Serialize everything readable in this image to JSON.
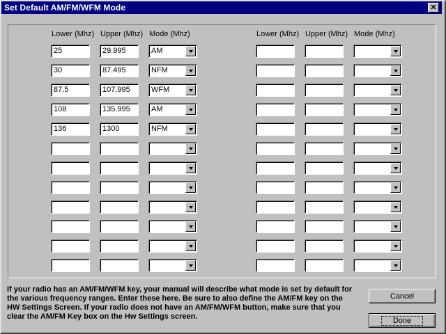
{
  "window": {
    "title": "Set Default AM/FM/WFM Mode"
  },
  "headers": {
    "lower": "Lower (Mhz)",
    "upper": "Upper (Mhz)",
    "mode": "Mode (Mhz)"
  },
  "left_rows": [
    {
      "lower": "25",
      "upper": "29.995",
      "mode": "AM"
    },
    {
      "lower": "30",
      "upper": "87.495",
      "mode": "NFM"
    },
    {
      "lower": "87.5",
      "upper": "107.995",
      "mode": "WFM"
    },
    {
      "lower": "108",
      "upper": "135.995",
      "mode": "AM"
    },
    {
      "lower": "136",
      "upper": "1300",
      "mode": "NFM"
    },
    {
      "lower": "",
      "upper": "",
      "mode": ""
    },
    {
      "lower": "",
      "upper": "",
      "mode": ""
    },
    {
      "lower": "",
      "upper": "",
      "mode": ""
    },
    {
      "lower": "",
      "upper": "",
      "mode": ""
    },
    {
      "lower": "",
      "upper": "",
      "mode": ""
    },
    {
      "lower": "",
      "upper": "",
      "mode": ""
    },
    {
      "lower": "",
      "upper": "",
      "mode": ""
    }
  ],
  "right_rows": [
    {
      "lower": "",
      "upper": "",
      "mode": ""
    },
    {
      "lower": "",
      "upper": "",
      "mode": ""
    },
    {
      "lower": "",
      "upper": "",
      "mode": ""
    },
    {
      "lower": "",
      "upper": "",
      "mode": ""
    },
    {
      "lower": "",
      "upper": "",
      "mode": ""
    },
    {
      "lower": "",
      "upper": "",
      "mode": ""
    },
    {
      "lower": "",
      "upper": "",
      "mode": ""
    },
    {
      "lower": "",
      "upper": "",
      "mode": ""
    },
    {
      "lower": "",
      "upper": "",
      "mode": ""
    },
    {
      "lower": "",
      "upper": "",
      "mode": ""
    },
    {
      "lower": "",
      "upper": "",
      "mode": ""
    },
    {
      "lower": "",
      "upper": "",
      "mode": ""
    }
  ],
  "help_text": "If your radio has an AM/FM/WFM key, your manual will describe what mode is set by default for the various frequency ranges. Enter these here. Be sure to also define the AM/FM key on the HW Settings Screen. If your radio does not have an AM/FM/WFM button, make sure that you clear the AM/FM Key box on the Hw Settings screen.",
  "buttons": {
    "cancel": "Cancel",
    "done": "Done"
  }
}
